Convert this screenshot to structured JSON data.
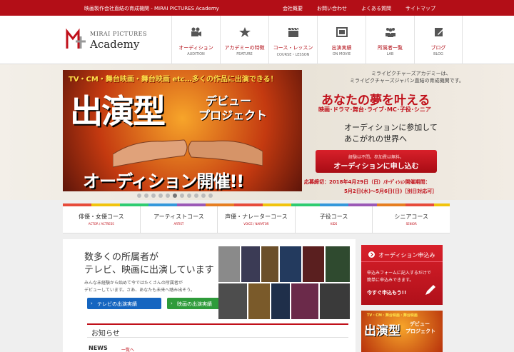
{
  "topbar": {
    "tagline": "映画製作会社直結の育成機関 - MIRAI PICTURES Academy",
    "links": [
      "会社概要",
      "お問い合わせ",
      "よくある質問",
      "サイトマップ"
    ]
  },
  "logo": {
    "line1": "MIRAI PICTURES",
    "line2": "Academy"
  },
  "nav": [
    {
      "jp": "オーディション",
      "en": "AUDITION",
      "icon": "film-camera-icon"
    },
    {
      "jp": "アカデミーの特徴",
      "en": "FEATURE",
      "icon": "star-icon"
    },
    {
      "jp": "コース・レッスン",
      "en": "COURSE・LESSON",
      "icon": "clapperboard-icon"
    },
    {
      "jp": "出演実績",
      "en": "ON MOVIE",
      "icon": "film-strip-icon"
    },
    {
      "jp": "所属者一覧",
      "en": "LAB",
      "icon": "people-icon"
    },
    {
      "jp": "ブログ",
      "en": "BLOG",
      "icon": "pencil-icon"
    }
  ],
  "banner": {
    "top": "TV・CM・舞台映画・舞台映画 etc…多くの作品に出演できる！",
    "main": "出演型",
    "sub1": "デビュー",
    "sub2": "プロジェクト",
    "bottom": "オーディション開催!!"
  },
  "slider": {
    "count": 11,
    "active": 5
  },
  "pitch": {
    "intro1": "ミライピクチャーズアカデミーは、",
    "intro2": "ミライピクチャーズジャパン直結の育成機関です。",
    "dream": "あなたの夢を叶える",
    "genres": "映画･ドラマ･舞台･ライブ･MC･子役･シニア",
    "world1": "オーディションに参加して",
    "world2": "あこがれの世界へ",
    "apply_note": "経験は不問。参加費は無料。",
    "apply_label": "オーディションに申し込む",
    "deadline1": "応募締切：2018年4月29日（日）/ｵｰﾃﾞｨｼｮﾝ開催期間：",
    "deadline2": "5月2日(水)〜5月6日(日)［別日対応可］"
  },
  "courses": [
    {
      "jp": "俳優・女優コース",
      "en": "ACTOR / ACTRESS"
    },
    {
      "jp": "アーティストコース",
      "en": "ARTIST"
    },
    {
      "jp": "声優・ナレーターコース",
      "en": "VOICE / NARATOR"
    },
    {
      "jp": "子役コース",
      "en": "KIDS"
    },
    {
      "jp": "シニアコース",
      "en": "SENIOR"
    }
  ],
  "main": {
    "headline1": "数多くの所属者が",
    "headline2": "テレビ、映画に出演しています",
    "desc1": "みんな未経験から始めて今ではたくさんの所属者が",
    "desc2": "デビューしています。さあ、あなたも未来へ踏み出そう。",
    "tv_label": "テレビの出演実績",
    "movie_label": "映画の出演実績",
    "notice_title": "お知らせ",
    "news_label": "NEWS",
    "news_link": "一覧へ"
  },
  "side": {
    "cta_title": "オーディション申込み",
    "cta_desc1": "申込みフォームに記入するだけで",
    "cta_desc2": "簡単に申込みできます。",
    "cta_go": "今すぐ申込もう!!",
    "banner_top": "TV・CM・舞台映画・舞台映画",
    "banner_main": "出演型",
    "banner_sub1": "デビュー",
    "banner_sub2": "プロジェクト"
  },
  "colors": {
    "brand_red": "#b30e17",
    "tv_blue": "#1565c0",
    "movie_green": "#2e9b3a"
  }
}
